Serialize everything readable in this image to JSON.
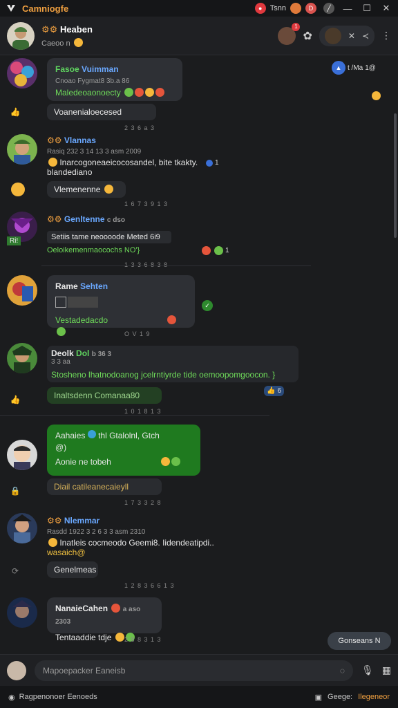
{
  "titlebar": {
    "app_title": "Camniogfe",
    "user_label": "Tsnn",
    "badge_label": "D"
  },
  "header": {
    "name": "Heaben",
    "subtitle": "Caeoo n",
    "notif_count": "1"
  },
  "top_right": {
    "label": "t /Ma",
    "count": "1@"
  },
  "messages": [
    {
      "name_a": "Fasoe",
      "name_b": "Vuimman",
      "meta": "Cnoao  Fygmat8  3b.a 86",
      "text": "Maledeoaonoecty",
      "sub": "Voanenialoecesed",
      "time": "2 3 6 a 3"
    },
    {
      "name_prefix": "⚙⚙",
      "name_b": "Vlannas",
      "meta": "Rasiq 232  3 14 13  3 asm  2009",
      "text": "Inarcogoneaeicocosandel, bite tkakty.",
      "text2": "blandediano",
      "count": "1",
      "sub": "Vlemenenne",
      "time": "1 6 7 3 9 1 3"
    },
    {
      "name_prefix": "⚙⚙",
      "name_b": "Genltenne",
      "meta": "c dso",
      "text": "Setiis   tame   neoooode   Meted  6i9",
      "text2": "Oeloikemenmaocochs NO'}",
      "count": "1",
      "side_tag": "Ri!",
      "time": "1 3 3 6 8 3 8"
    },
    {
      "name_a": "Rame",
      "name_b": "Sehten",
      "text": "Vestadedacdo",
      "time": "O V 1 9"
    },
    {
      "name_a": "Deolk",
      "name_b": "Dol",
      "meta": "b 36  3",
      "meta2": "3 3 aa",
      "text": "Stosheno  lhatnodoanog  jcelrntiyrde  tide oemoopomgoocon.  }",
      "sub": "Inaltsdenn  Comanaa80",
      "react": "6",
      "time": "1 0 1 8 1 3"
    },
    {
      "name_a": "Aahaies",
      "name_b": "thl  Gtalolnl, Gtch",
      "text_line2": "@)",
      "text": "Aonie ne tobeh",
      "sub": "Diail  catileanecaieyll",
      "time": "1 7 3 3 2 8"
    },
    {
      "name_prefix": "⚙⚙",
      "name_b": "Nlemmar",
      "meta": "Rasdd 1922  3 2 6 3  3 asm  2310",
      "text": "Inatleis  cocmeodo  Geemi8.  Iidendeatipdi..",
      "text2": "wasaich@",
      "sub": "Genelmeas",
      "time": "1 2 8 3 6 6 1 3"
    },
    {
      "name_a": "NanaieCahen",
      "meta": "a aso  2303",
      "text": "Tentaaddie  tdje",
      "time": "2 8 8 3 1 3"
    }
  ],
  "float_button": "Gonseans",
  "float_button_icon": "N",
  "composer": {
    "placeholder": "Mapoepacker Eaneisb"
  },
  "statusbar": {
    "left": "Ragpenonoer  Eenoeds",
    "right_a": "Geege:",
    "right_b": "Ilegeneor"
  },
  "colors": {
    "accent": "#f0a040",
    "green_bubble": "#1f7a1f",
    "link_blue": "#6aa8ff",
    "green_text": "#6fdc5a"
  }
}
